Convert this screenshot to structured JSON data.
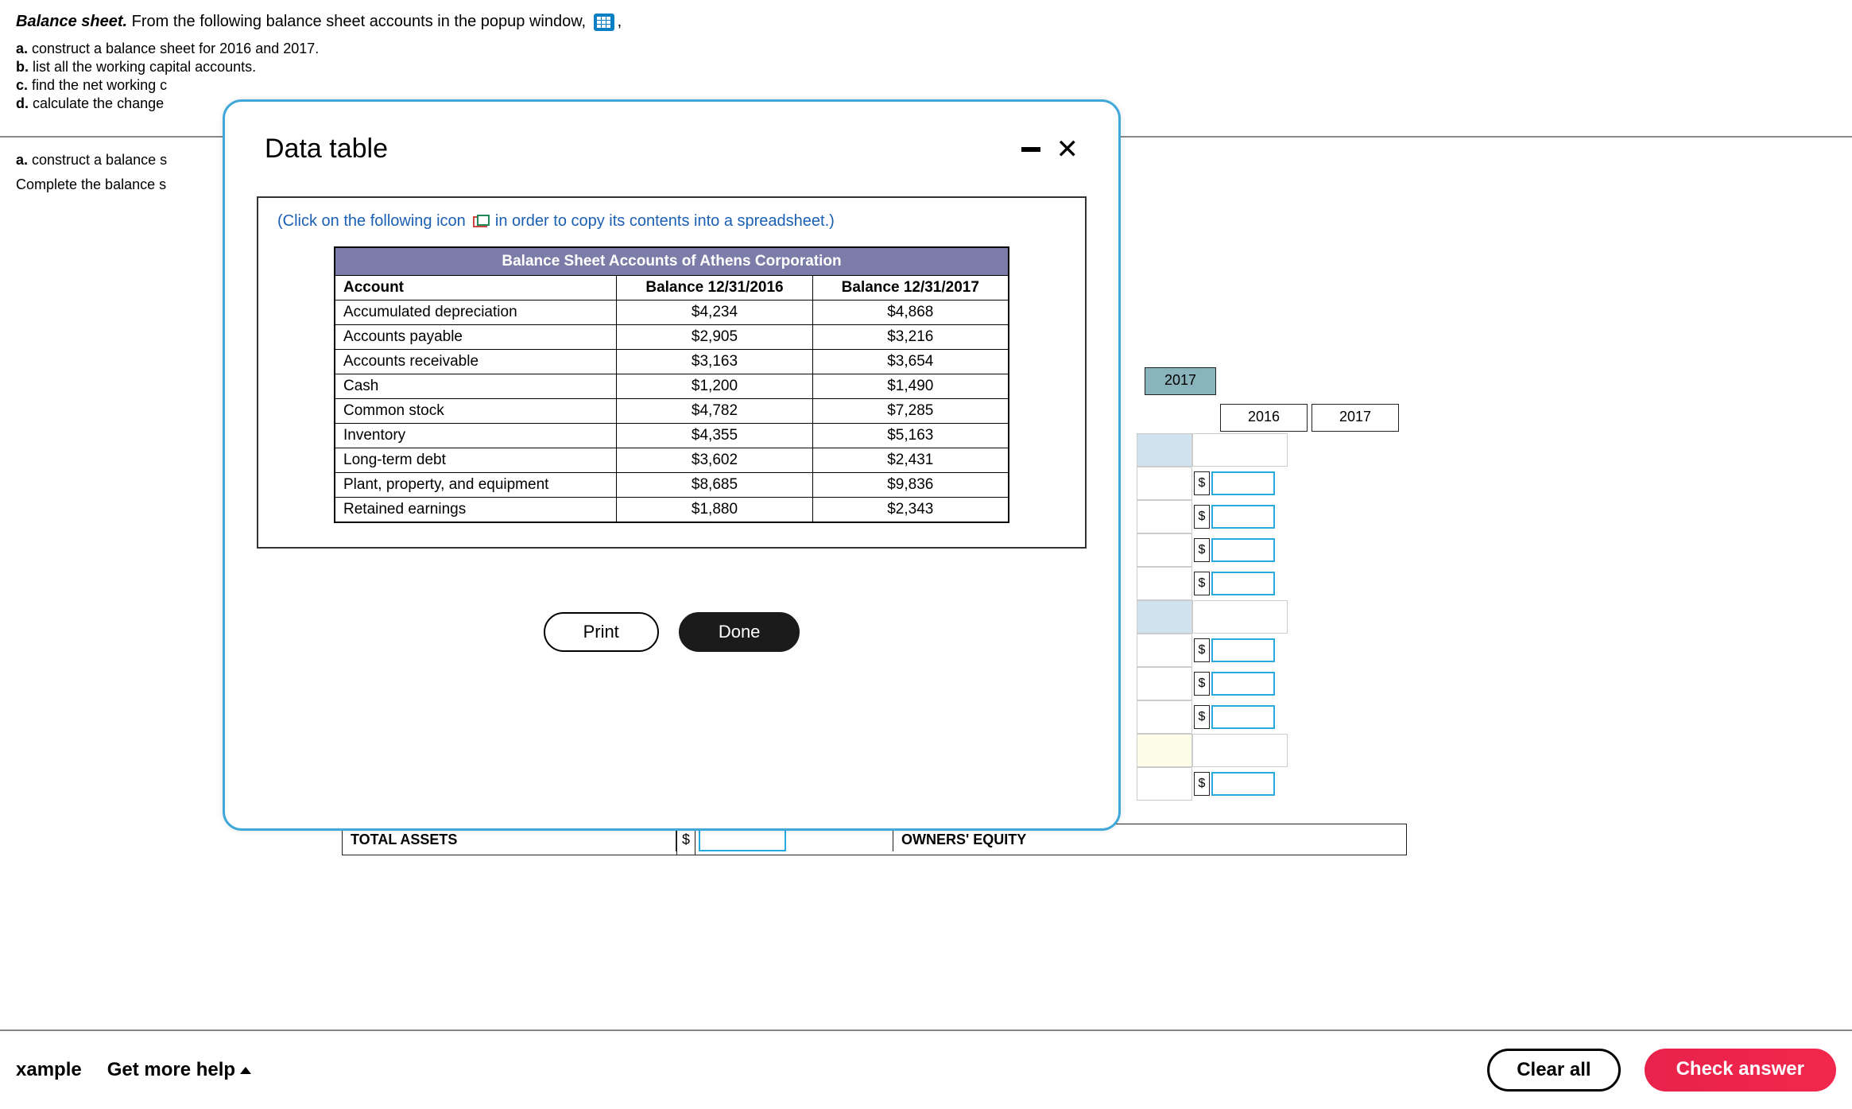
{
  "header": {
    "title_bold": "Balance sheet.",
    "title_rest": " From the following balance sheet accounts in the popup window,",
    "comma": ","
  },
  "instructions": {
    "a_label": "a.",
    "a_text": " construct a balance sheet for 2016 and 2017.",
    "b_label": "b.",
    "b_text": " list all the working capital accounts.",
    "c_label": "c.",
    "c_text": " find the net working c",
    "d_label": "d.",
    "d_text": " calculate the change"
  },
  "subheader": {
    "line1_label": "a.",
    "line1_text": " construct a balance s",
    "line2": "Complete the balance s"
  },
  "modal": {
    "title": "Data table",
    "hint_pre": "(Click on the following icon ",
    "hint_post": " in order to copy its contents into a spreadsheet.)",
    "table_caption": "Balance Sheet Accounts of Athens Corporation",
    "col0": "Account",
    "col1": "Balance 12/31/2016",
    "col2": "Balance 12/31/2017",
    "rows": [
      {
        "acct": "Accumulated depreciation",
        "v1": "$4,234",
        "v2": "$4,868"
      },
      {
        "acct": "Accounts payable",
        "v1": "$2,905",
        "v2": "$3,216"
      },
      {
        "acct": "Accounts receivable",
        "v1": "$3,163",
        "v2": "$3,654"
      },
      {
        "acct": "Cash",
        "v1": "$1,200",
        "v2": "$1,490"
      },
      {
        "acct": "Common stock",
        "v1": "$4,782",
        "v2": "$7,285"
      },
      {
        "acct": "Inventory",
        "v1": "$4,355",
        "v2": "$5,163"
      },
      {
        "acct": "Long-term debt",
        "v1": "$3,602",
        "v2": "$2,431"
      },
      {
        "acct": "Plant, property, and equipment",
        "v1": "$8,685",
        "v2": "$9,836"
      },
      {
        "acct": "Retained earnings",
        "v1": "$1,880",
        "v2": "$2,343"
      }
    ],
    "print": "Print",
    "done": "Done"
  },
  "bg_sheet": {
    "year_big": "2017",
    "year_a": "2016",
    "year_b": "2017",
    "dollar": "$"
  },
  "totals": {
    "total_assets": "TOTAL ASSETS",
    "dollar": "$",
    "owners_equity": "OWNERS' EQUITY"
  },
  "footer": {
    "example": "xample",
    "get_more_help": "Get more help",
    "clear_all": "Clear all",
    "check_answer": "Check answer"
  }
}
